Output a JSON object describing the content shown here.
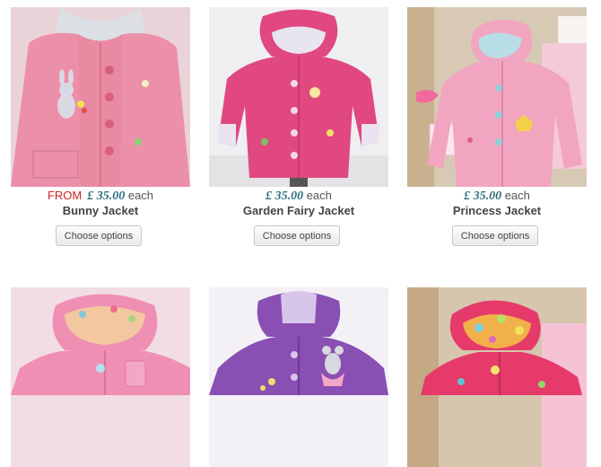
{
  "products": [
    {
      "name": "Bunny Jacket",
      "from_label": "FROM",
      "price": "£ 35.00",
      "each": "each",
      "button": "Choose options"
    },
    {
      "name": "Garden Fairy Jacket",
      "from_label": "",
      "price": "£ 35.00",
      "each": "each",
      "button": "Choose options"
    },
    {
      "name": "Princess Jacket",
      "from_label": "",
      "price": "£ 35.00",
      "each": "each",
      "button": "Choose options"
    }
  ],
  "colors": {
    "from_red": "#cc2222",
    "price_teal": "#2e6f7f",
    "title_grey": "#444444",
    "bunny_pink": "#ec8fa8",
    "fairy_pink": "#e0487f",
    "princess_pink": "#f2a5c0",
    "row2_pink": "#f08fb4",
    "row2_purple": "#8a4fb3",
    "row2_red": "#e63b6a"
  }
}
